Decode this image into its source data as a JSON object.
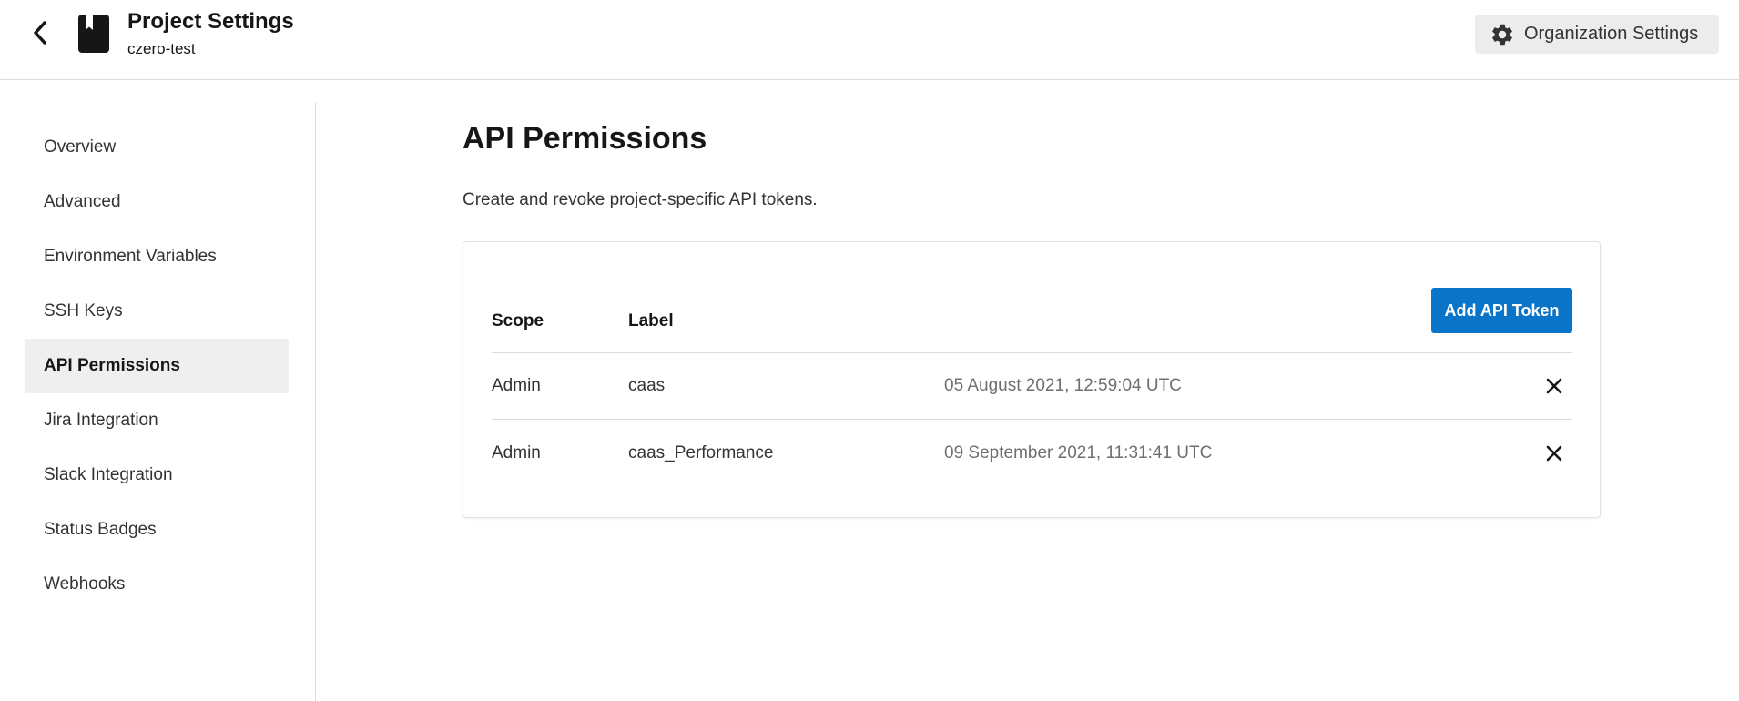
{
  "header": {
    "title": "Project Settings",
    "subtitle": "czero-test",
    "org_settings_label": "Organization Settings",
    "icons": {
      "back": "back-arrow-icon",
      "project": "bookmark-book-icon",
      "org": "gear-icon"
    }
  },
  "sidebar": {
    "items": [
      {
        "label": "Overview",
        "active": false
      },
      {
        "label": "Advanced",
        "active": false
      },
      {
        "label": "Environment Variables",
        "active": false
      },
      {
        "label": "SSH Keys",
        "active": false
      },
      {
        "label": "API Permissions",
        "active": true
      },
      {
        "label": "Jira Integration",
        "active": false
      },
      {
        "label": "Slack Integration",
        "active": false
      },
      {
        "label": "Status Badges",
        "active": false
      },
      {
        "label": "Webhooks",
        "active": false
      }
    ]
  },
  "main": {
    "title": "API Permissions",
    "description": "Create and revoke project-specific API tokens.",
    "table": {
      "headers": {
        "scope": "Scope",
        "label": "Label"
      },
      "add_button_label": "Add API Token",
      "rows": [
        {
          "scope": "Admin",
          "label": "caas",
          "created": "05 August 2021, 12:59:04 UTC"
        },
        {
          "scope": "Admin",
          "label": "caas_Performance",
          "created": "09 September 2021, 11:31:41 UTC"
        }
      ]
    }
  },
  "colors": {
    "accent": "#0a74c9",
    "active_nav_bg": "#efefef",
    "org_button_bg": "#ececec"
  }
}
